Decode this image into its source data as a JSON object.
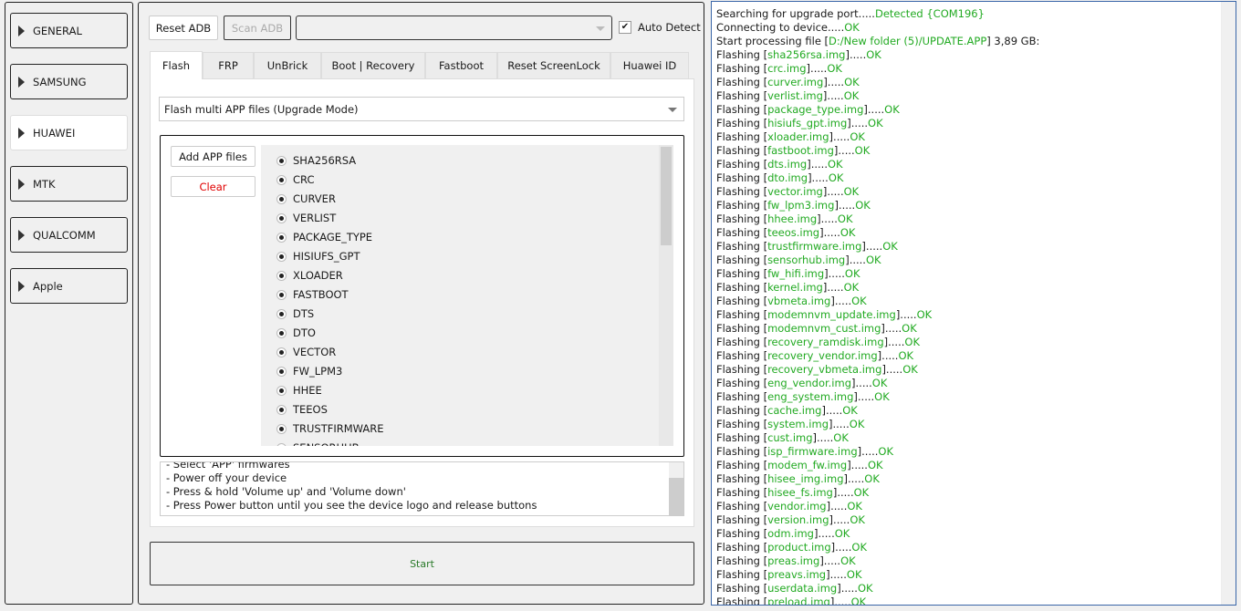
{
  "sidebar": {
    "items": [
      {
        "label": "GENERAL",
        "selected": false
      },
      {
        "label": "SAMSUNG",
        "selected": false
      },
      {
        "label": "HUAWEI",
        "selected": true
      },
      {
        "label": "MTK",
        "selected": false
      },
      {
        "label": "QUALCOMM",
        "selected": false
      },
      {
        "label": "Apple",
        "selected": false
      }
    ]
  },
  "toolbar": {
    "reset_adb": "Reset ADB",
    "scan_adb": "Scan ADB",
    "port_value": "",
    "auto_detect": "Auto Detect",
    "auto_detect_checked": true
  },
  "tabs": [
    "Flash",
    "FRP",
    "UnBrick",
    "Boot | Recovery",
    "Fastboot",
    "Reset ScreenLock",
    "Huawei ID"
  ],
  "active_tab": "Flash",
  "mode_select": "Flash multi APP files (Upgrade Mode)",
  "add_app_files": "Add APP files",
  "clear": "Clear",
  "partitions": [
    "SHA256RSA",
    "CRC",
    "CURVER",
    "VERLIST",
    "PACKAGE_TYPE",
    "HISIUFS_GPT",
    "XLOADER",
    "FASTBOOT",
    "DTS",
    "DTO",
    "VECTOR",
    "FW_LPM3",
    "HHEE",
    "TEEOS",
    "TRUSTFIRMWARE",
    "SENSORHUB"
  ],
  "instructions": [
    "- Select 'APP' firmwares",
    "- Power off your device",
    "- Press & hold 'Volume up' and 'Volume down'",
    "- Press Power button until you see the device logo and release buttons"
  ],
  "start": "Start",
  "colors": {
    "ok": "#22aa22",
    "clear": "#e00000",
    "start": "#2a7a2a",
    "log_border": "#3a66a8"
  },
  "log": {
    "header": [
      [
        {
          "t": "Searching for upgrade port.....",
          "g": false
        },
        {
          "t": "Detected {COM196}",
          "g": true
        }
      ],
      [
        {
          "t": "Connecting to device.....",
          "g": false
        },
        {
          "t": "OK",
          "g": true
        }
      ],
      [
        {
          "t": "Start processing file [",
          "g": false
        },
        {
          "t": "D:/New folder (5)/UPDATE.APP",
          "g": true
        },
        {
          "t": "] 3,89 GB:",
          "g": false
        }
      ]
    ],
    "flash_prefix": "Flashing [",
    "flash_mid": "].....",
    "status": "OK",
    "files": [
      "sha256rsa.img",
      "crc.img",
      "curver.img",
      "verlist.img",
      "package_type.img",
      "hisiufs_gpt.img",
      "xloader.img",
      "fastboot.img",
      "dts.img",
      "dto.img",
      "vector.img",
      "fw_lpm3.img",
      "hhee.img",
      "teeos.img",
      "trustfirmware.img",
      "sensorhub.img",
      "fw_hifi.img",
      "kernel.img",
      "vbmeta.img",
      "modemnvm_update.img",
      "modemnvm_cust.img",
      "recovery_ramdisk.img",
      "recovery_vendor.img",
      "recovery_vbmeta.img",
      "eng_vendor.img",
      "eng_system.img",
      "cache.img",
      "system.img",
      "cust.img",
      "isp_firmware.img",
      "modem_fw.img",
      "hisee_img.img",
      "hisee_fs.img",
      "vendor.img",
      "version.img",
      "odm.img",
      "product.img",
      "preas.img",
      "preavs.img",
      "userdata.img",
      "preload.img"
    ]
  }
}
